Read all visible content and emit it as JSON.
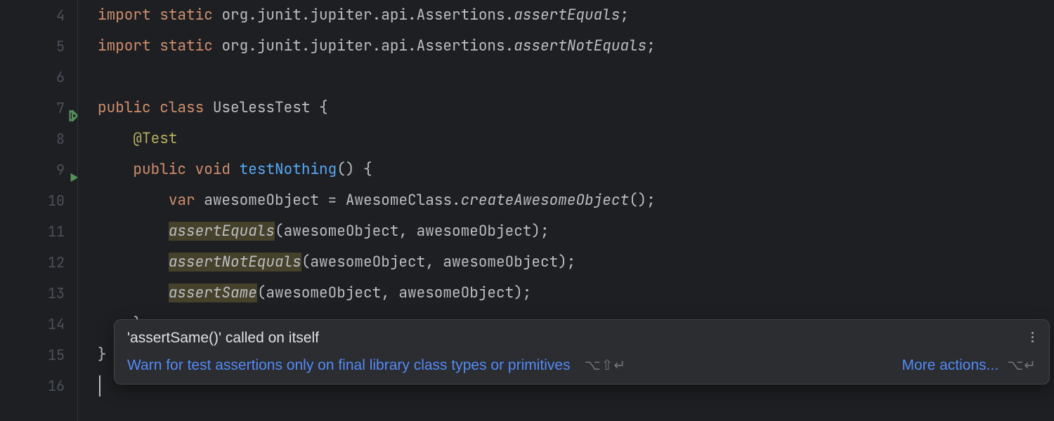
{
  "lineNumbers": [
    "4",
    "5",
    "6",
    "7",
    "8",
    "9",
    "10",
    "11",
    "12",
    "13",
    "14",
    "15",
    "16"
  ],
  "code": {
    "l4": {
      "kw1": "import",
      "kw2": "static",
      "pkg": "org.junit.jupiter.api.Assertions.",
      "ident": "assertEquals",
      "semi": ";"
    },
    "l5": {
      "kw1": "import",
      "kw2": "static",
      "pkg": "org.junit.jupiter.api.Assertions.",
      "ident": "assertNotEquals",
      "semi": ";"
    },
    "l7": {
      "kw1": "public",
      "kw2": "class",
      "name": "UselessTest",
      "brace": " {"
    },
    "l8": {
      "ann": "@Test"
    },
    "l9": {
      "kw1": "public",
      "kw2": "void",
      "name": "testNothing",
      "rest": "() {"
    },
    "l10": {
      "kw": "var",
      "var": "awesomeObject",
      "eq": " = ",
      "cls": "AwesomeClass.",
      "call": "createAwesomeObject",
      "rest": "();"
    },
    "l11": {
      "call": "assertEquals",
      "rest": "(awesomeObject, awesomeObject);"
    },
    "l12": {
      "call": "assertNotEquals",
      "rest": "(awesomeObject, awesomeObject);"
    },
    "l13": {
      "call": "assertSame",
      "rest": "(awesomeObject, awesomeObject);"
    },
    "l14": {
      "brace": "}"
    },
    "l15": {
      "brace": "}"
    }
  },
  "tooltip": {
    "title": "'assertSame()' called on itself",
    "link": "Warn for test assertions only on final library class types or primitives",
    "shortcut1": "⌥⇧↵",
    "more": "More actions...",
    "shortcut2": "⌥↵"
  }
}
